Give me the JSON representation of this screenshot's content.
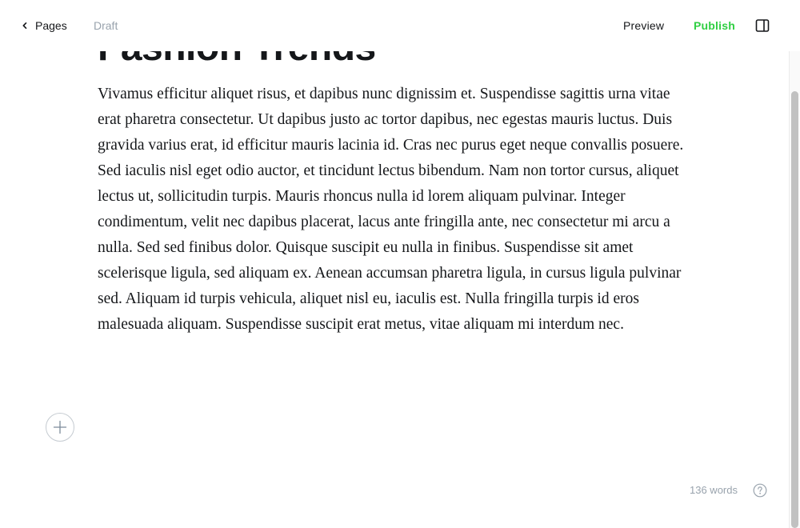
{
  "header": {
    "back_label": "Pages",
    "status": "Draft",
    "preview_label": "Preview",
    "publish_label": "Publish",
    "accent_color": "#30cf43"
  },
  "post": {
    "title": "Fashion Trends",
    "body": "Vivamus efficitur aliquet risus, et dapibus nunc dignissim et. Suspendisse sagittis urna vitae erat pharetra consectetur. Ut dapibus justo ac tortor dapibus, nec egestas mauris luctus. Duis gravida varius erat, id efficitur mauris lacinia id. Cras nec purus eget neque convallis posuere. Sed iaculis nisl eget odio auctor, et tincidunt lectus bibendum. Nam non tortor cursus, aliquet lectus ut, sollicitudin turpis. Mauris rhoncus nulla id lorem aliquam pulvinar. Integer condimentum, velit nec dapibus placerat, lacus ante fringilla ante, nec consectetur mi arcu a nulla. Sed sed finibus dolor. Quisque suscipit eu nulla in finibus. Suspendisse sit amet scelerisque ligula, sed aliquam ex. Aenean accumsan pharetra ligula, in cursus ligula pulvinar sed. Aliquam id turpis vehicula, aliquet nisl eu, iaculis est. Nulla fringilla turpis id eros malesuada aliquam. Suspendisse suscipit erat metus, vitae aliquam mi interdum nec."
  },
  "footer": {
    "word_count": "136 words"
  },
  "icons": {
    "back": "chevron-left-icon",
    "panel": "sidebar-panel-icon",
    "add": "plus-icon",
    "help": "question-mark-icon"
  }
}
